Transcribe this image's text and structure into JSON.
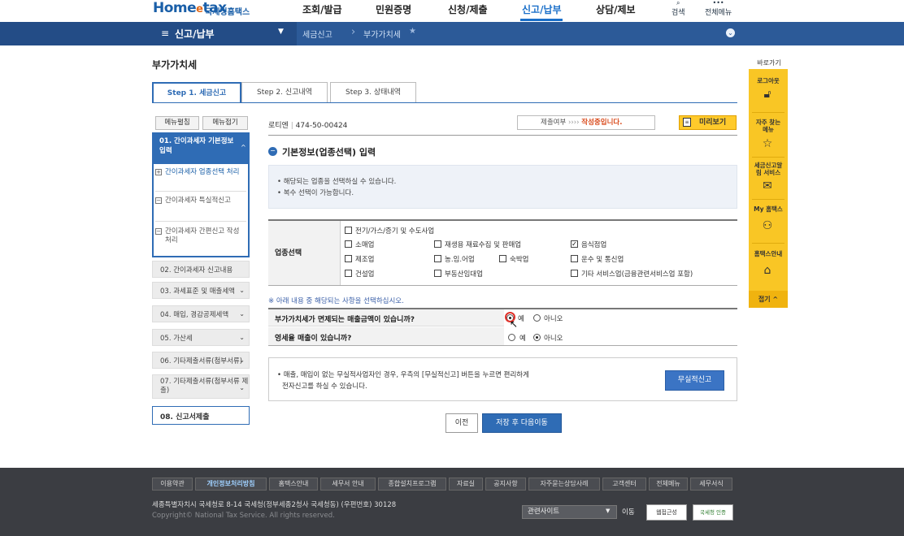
{
  "header": {
    "logo_main": "Home",
    "logo_e": "e",
    "logo_tail": "tax",
    "logo_sub": "국세청홈택스",
    "nav": [
      "조회/발급",
      "민원증명",
      "신청/제출",
      "신고/납부",
      "상담/제보"
    ],
    "active_nav": "신고/납부",
    "util_search": "검색",
    "util_menu": "전체메뉴"
  },
  "subbar": {
    "title": "신고/납부",
    "crumb1": "세금신고",
    "crumb2": "부가가치세",
    "star": "★"
  },
  "page": {
    "title": "부가가치세",
    "tabs": [
      "Step 1. 세금신고",
      "Step 2. 신고내역",
      "Step 3. 상태내역"
    ]
  },
  "sidebar": {
    "btn_expand": "메뉴펼침",
    "btn_collapse": "메뉴접기",
    "head": "01. 간이과세자 기본정보 입력",
    "subs": [
      {
        "mark": "+",
        "label": "간이과세자 업종선택 처리"
      },
      {
        "mark": "−",
        "label": "간이과세자 특실적신고"
      },
      {
        "mark": "−",
        "label": "간이과세자 간편신고 작성 처리"
      }
    ],
    "items": [
      "02. 간이과세자 신고내용",
      "03. 과세표준 및 매출세액",
      "04. 매입, 경감공제세액",
      "05. 가산세",
      "06. 기타제출서류(첨부서류)",
      "07. 기타제출서류(첨부서류 제출)"
    ],
    "last": "08. 신고서제출"
  },
  "main": {
    "biz_label": "로티엔",
    "biz_sep": "|",
    "biz_no": "474-50-00424",
    "status_prefix": "제출여부",
    "status_arrows": "››››",
    "status_value": "작성중입니다.",
    "preview_label": "미리보기",
    "section_title": "기본정보(업종선택) 입력",
    "info": [
      "• 해당되는 업종을 선택하실 수 있습니다.",
      "• 복수 선택이 가능합니다."
    ],
    "biz_th": "업종선택",
    "checkbox_top": "전기/가스/증기 및 수도사업",
    "checkboxes": [
      {
        "label": "소매업",
        "checked": false
      },
      {
        "label": "재생용 재료수집 및 판매업",
        "checked": false
      },
      {
        "label": "음식점업",
        "checked": true
      },
      {
        "label": "제조업",
        "checked": false
      },
      {
        "label": "농.임.어업",
        "checked": false
      },
      {
        "label": "숙박업",
        "checked": false
      },
      {
        "label": "운수 및 통신업",
        "checked": false
      },
      {
        "label": "건설업",
        "checked": false
      },
      {
        "label": "부동산임대업",
        "checked": false
      },
      {
        "label": "기타 서비스업(금융관련서비스업 포함)",
        "checked": false
      }
    ],
    "note": "※ 아래 내용 중 해당되는 사항을 선택하십시오.",
    "q1": "부가가치세가 면제되는 매출금액이 있습니까?",
    "q2": "영세율 매출이 있습니까?",
    "yes": "예",
    "no": "아니오",
    "q1_answer": "yes",
    "q2_answer": "no",
    "notice": [
      "• 매출, 매입이 없는 무실적사업자인 경우, 우측의 [무실적신고] 버튼을 누르면 편리하게",
      "전자신고를 하실 수 있습니다."
    ],
    "nosales_btn": "무실적신고",
    "prev_btn": "이전",
    "save_btn": "저장 후 다음이동"
  },
  "quickbar": {
    "title": "바로가기",
    "logout": "로그아웃",
    "faq": "자주 찾는 메뉴",
    "notify": "세금신고알림 서비스",
    "mytax": "My 홈택스",
    "guide": "홈택스안내",
    "collapse": "접기 ^"
  },
  "footer": {
    "links": [
      "이용약관",
      "개인정보처리방침",
      "홈택스안내",
      "세무서 안내",
      "종합설치프로그램",
      "자료실",
      "공지사항",
      "자주묻는상담사례",
      "고객센터",
      "전체메뉴",
      "세무서식"
    ],
    "highlight": "개인정보처리방침",
    "address": "세종특별자치시 국세청로 8-14 국세청(정부세종2청사 국세청동) (우편번호) 30128",
    "copyright": "Copyright© National Tax Service. All rights reserved.",
    "site_select": "관련사이트",
    "go": "이동",
    "badge1": "웹접근성",
    "badge2": "국세청 인증"
  },
  "colors": {
    "brand_blue": "#2f6cb5",
    "subbar": "#2c5a98",
    "quick_yellow": "#f9c625",
    "status_red": "#d94a1b",
    "footer_bg": "#3b3d42"
  }
}
